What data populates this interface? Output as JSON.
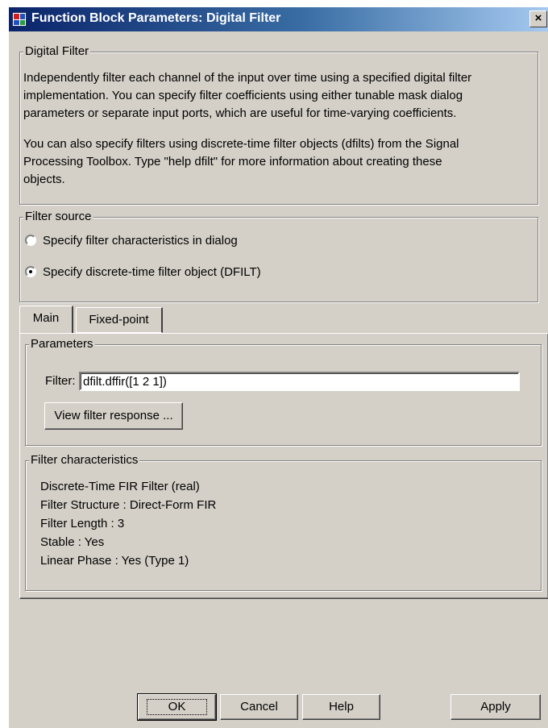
{
  "window": {
    "title": "Function Block Parameters: Digital Filter",
    "close_glyph": "×"
  },
  "digital_filter": {
    "legend": "Digital Filter",
    "paragraph1": [
      "Independently filter each channel of the input over time using a specified digital filter",
      "implementation. You can specify filter coefficients using either tunable mask dialog",
      "parameters or separate input ports, which are useful for time-varying coefficients."
    ],
    "paragraph2": [
      "You can also specify filters using discrete-time filter objects (dfilts) from the Signal",
      "Processing Toolbox. Type \"help dfilt\" for more information about creating these",
      "objects."
    ]
  },
  "filter_source": {
    "legend": "Filter source",
    "options": [
      {
        "label": "Specify filter characteristics in dialog",
        "selected": false
      },
      {
        "label": "Specify discrete-time filter object (DFILT)",
        "selected": true
      }
    ]
  },
  "tabs": [
    {
      "label": "Main",
      "active": true
    },
    {
      "label": "Fixed-point",
      "active": false
    }
  ],
  "parameters": {
    "legend": "Parameters",
    "filter_label": "Filter:",
    "filter_value": "dfilt.dffir([1 2 1])",
    "view_button": "View filter response ..."
  },
  "filter_characteristics": {
    "legend": "Filter characteristics",
    "lines": [
      "Discrete-Time FIR Filter (real)",
      "Filter Structure : Direct-Form FIR",
      "Filter Length : 3",
      "Stable : Yes",
      "Linear Phase : Yes (Type 1)"
    ]
  },
  "footer": {
    "ok": "OK",
    "cancel": "Cancel",
    "help": "Help",
    "apply": "Apply"
  }
}
